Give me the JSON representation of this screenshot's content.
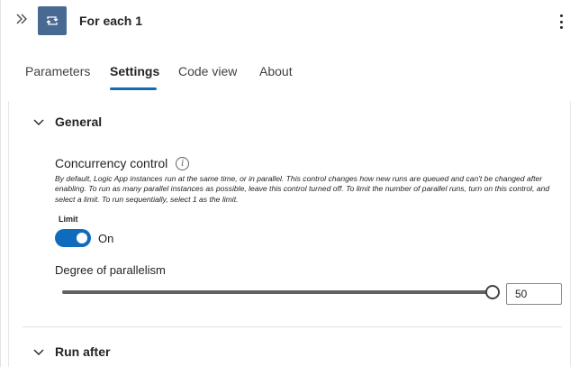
{
  "header": {
    "title": "For each 1",
    "collapse_icon": "chevron-double-right-icon",
    "action_icon": "loop-icon",
    "action_color": "#486991",
    "more_icon": "more-vertical-icon"
  },
  "tabs": [
    {
      "label": "Parameters",
      "active": false
    },
    {
      "label": "Settings",
      "active": true
    },
    {
      "label": "Code view",
      "active": false
    },
    {
      "label": "About",
      "active": false
    }
  ],
  "sections": {
    "general": {
      "label": "General",
      "expanded": true,
      "concurrency": {
        "label": "Concurrency control",
        "description": "By default, Logic App instances run at the same time, or in parallel. This control changes how new runs are queued and can't be changed after enabling. To run as many parallel instances as possible, leave this control turned off. To limit the number of parallel runs, turn on this control, and select a limit. To run sequentially, select 1 as the limit.",
        "toggle_label": "Limit",
        "toggle_state_text": "On",
        "toggle_on": true,
        "parallelism_label": "Degree of parallelism",
        "parallelism_value": "50",
        "slider_level": 1.0
      }
    },
    "run_after": {
      "label": "Run after",
      "expanded": false
    }
  },
  "colors": {
    "accent": "#0f6cbd",
    "text": "#242424"
  }
}
